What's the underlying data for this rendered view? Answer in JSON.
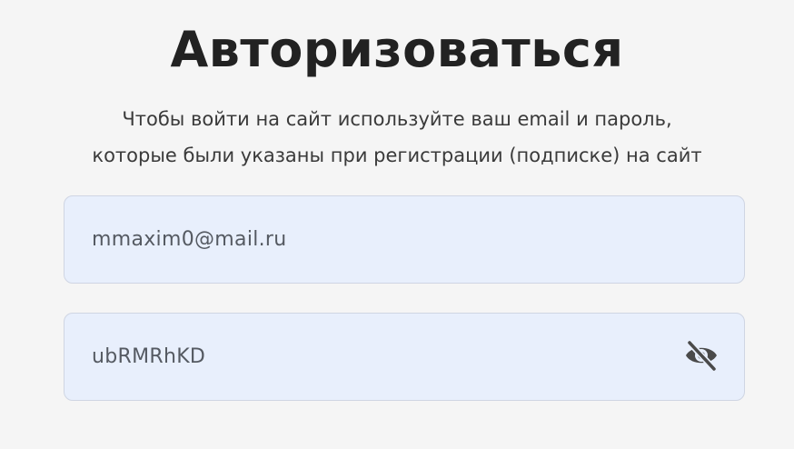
{
  "header": {
    "title": "Авторизоваться",
    "subtitle_line1": "Чтобы войти на сайт используйте ваш email и пароль,",
    "subtitle_line2": "которые были указаны при регистрации (подписке) на сайт"
  },
  "form": {
    "email_value": "mmaxim0@mail.ru",
    "password_value": "ubRMRhKD",
    "password_visibility_icon": "eye-slash-icon"
  },
  "colors": {
    "background": "#f5f5f5",
    "input_background": "#e8effc",
    "input_border": "#cfd5e3",
    "title": "#222222",
    "icon": "#4a4a4a"
  }
}
